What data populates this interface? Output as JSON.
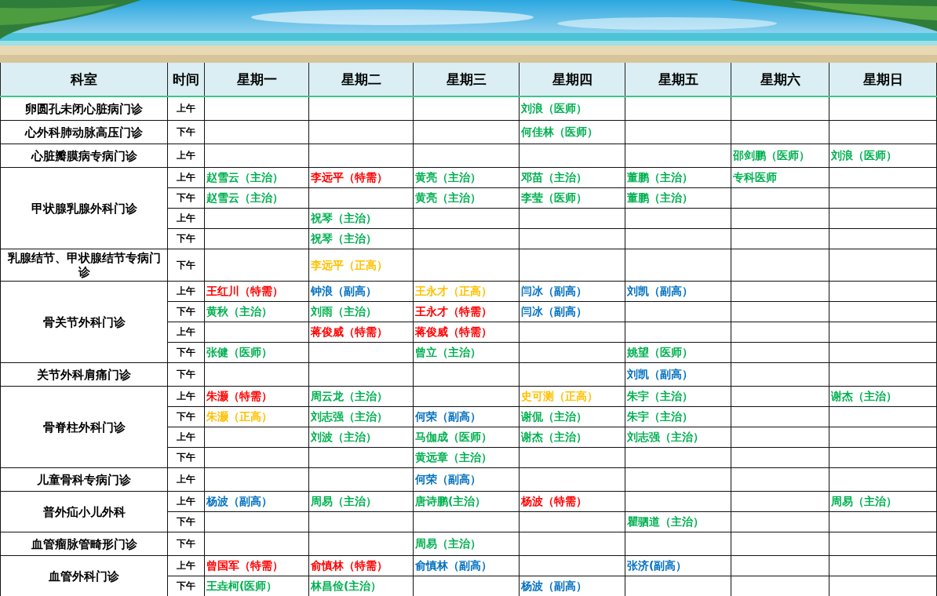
{
  "header": [
    "科室",
    "时间",
    "星期一",
    "星期二",
    "星期三",
    "星期四",
    "星期五",
    "星期六",
    "星期日"
  ],
  "departments": [
    {
      "name": "卵圆孔未闭心脏病门诊",
      "slots": [
        {
          "time": "上午",
          "cells": [
            null,
            null,
            null,
            {
              "text": "刘浪（医师）",
              "color": "#00b050"
            },
            null,
            null,
            null
          ]
        }
      ]
    },
    {
      "name": "心外科肺动脉高压门诊",
      "slots": [
        {
          "time": "下午",
          "cells": [
            null,
            null,
            null,
            {
              "text": "何佳林（医师）",
              "color": "#00b050"
            },
            null,
            null,
            null
          ]
        }
      ]
    },
    {
      "name": "心脏瓣膜病专病门诊",
      "slots": [
        {
          "time": "上午",
          "cells": [
            null,
            null,
            null,
            null,
            null,
            {
              "text": "邵剑鹏（医师）",
              "color": "#00b050"
            },
            {
              "text": "刘浪（医师）",
              "color": "#00b050"
            }
          ]
        }
      ]
    },
    {
      "name": "甲状腺乳腺外科门诊",
      "slots": [
        {
          "time": "上午",
          "cells": [
            {
              "text": "赵雪云（主治）",
              "color": "#00b050"
            },
            {
              "text": "李远平（特需）",
              "color": "#ff0000"
            },
            {
              "text": "黄亮（主治）",
              "color": "#00b050"
            },
            {
              "text": "邓苗（主治）",
              "color": "#00b050"
            },
            {
              "text": "董鹏（主治）",
              "color": "#00b050"
            },
            {
              "text": "专科医师",
              "color": "#00b050"
            },
            null
          ]
        },
        {
          "time": "下午",
          "cells": [
            {
              "text": "赵雪云（主治）",
              "color": "#00b050"
            },
            null,
            {
              "text": "黄亮（主治）",
              "color": "#00b050"
            },
            {
              "text": "李莹（医师）",
              "color": "#00b050"
            },
            {
              "text": "董鹏（主治）",
              "color": "#00b050"
            },
            null,
            null
          ]
        },
        {
          "time": "上午",
          "cells": [
            null,
            {
              "text": "祝琴（主治）",
              "color": "#00b050"
            },
            null,
            null,
            null,
            null,
            null
          ]
        },
        {
          "time": "下午",
          "cells": [
            null,
            {
              "text": "祝琴（主治）",
              "color": "#00b050"
            },
            null,
            null,
            null,
            null,
            null
          ]
        }
      ]
    },
    {
      "name": "乳腺结节、甲状腺结节专病门诊",
      "slots": [
        {
          "time": "下午",
          "cells": [
            null,
            {
              "text": "李远平（正高）",
              "color": "#ffc000"
            },
            null,
            null,
            null,
            null,
            null
          ]
        }
      ]
    },
    {
      "name": "骨关节外科门诊",
      "slots": [
        {
          "time": "上午",
          "cells": [
            {
              "text": "王红川（特需）",
              "color": "#ff0000"
            },
            {
              "text": "钟浪（副高）",
              "color": "#0070c0"
            },
            {
              "text": "王永才（正高）",
              "color": "#ffc000"
            },
            {
              "text": "闫冰（副高）",
              "color": "#0070c0"
            },
            {
              "text": "刘凯（副高）",
              "color": "#0070c0"
            },
            null,
            null
          ]
        },
        {
          "time": "下午",
          "cells": [
            {
              "text": "黄秋（主治）",
              "color": "#00b050"
            },
            {
              "text": "刘雨（主治）",
              "color": "#00b050"
            },
            {
              "text": "王永才（特需）",
              "color": "#ff0000"
            },
            {
              "text": "闫冰（副高）",
              "color": "#0070c0"
            },
            null,
            null,
            null
          ]
        },
        {
          "time": "上午",
          "cells": [
            null,
            {
              "text": "蒋俊威（特需）",
              "color": "#ff0000"
            },
            {
              "text": "蒋俊威（特需）",
              "color": "#ff0000"
            },
            null,
            null,
            null,
            null
          ]
        },
        {
          "time": "下午",
          "cells": [
            {
              "text": "张健（医师）",
              "color": "#00b050"
            },
            null,
            {
              "text": "曾立（主治）",
              "color": "#00b050"
            },
            null,
            {
              "text": "姚望（医师）",
              "color": "#00b050"
            },
            null,
            null
          ]
        }
      ]
    },
    {
      "name": "关节外科肩痛门诊",
      "slots": [
        {
          "time": "下午",
          "cells": [
            null,
            null,
            null,
            null,
            {
              "text": "刘凯（副高）",
              "color": "#0070c0"
            },
            null,
            null
          ]
        }
      ]
    },
    {
      "name": "骨脊柱外科门诊",
      "slots": [
        {
          "time": "上午",
          "cells": [
            {
              "text": "朱灏（特需）",
              "color": "#ff0000"
            },
            {
              "text": "周云龙（主治）",
              "color": "#00b050"
            },
            null,
            {
              "text": "史可测（正高）",
              "color": "#ffc000"
            },
            {
              "text": "朱宇（主治）",
              "color": "#00b050"
            },
            null,
            {
              "text": "谢杰（主治）",
              "color": "#00b050"
            }
          ]
        },
        {
          "time": "下午",
          "cells": [
            {
              "text": "朱灏（正高）",
              "color": "#ffc000"
            },
            {
              "text": "刘志强（主治）",
              "color": "#00b050"
            },
            {
              "text": "何荣（副高）",
              "color": "#0070c0"
            },
            {
              "text": "谢侃（主治）",
              "color": "#00b050"
            },
            {
              "text": "朱宇（主治）",
              "color": "#00b050"
            },
            null,
            null
          ]
        },
        {
          "time": "上午",
          "cells": [
            null,
            {
              "text": "刘波（主治）",
              "color": "#00b050"
            },
            {
              "text": "马伽成（医师）",
              "color": "#00b050"
            },
            {
              "text": "谢杰（主治）",
              "color": "#00b050"
            },
            {
              "text": "刘志强（主治）",
              "color": "#00b050"
            },
            null,
            null
          ]
        },
        {
          "time": "下午",
          "cells": [
            null,
            null,
            {
              "text": "黄远章（主治）",
              "color": "#00b050"
            },
            null,
            null,
            null,
            null
          ]
        }
      ]
    },
    {
      "name": "儿童骨科专病门诊",
      "slots": [
        {
          "time": "上午",
          "cells": [
            null,
            null,
            {
              "text": "何荣（副高）",
              "color": "#0070c0"
            },
            null,
            null,
            null,
            null
          ]
        }
      ]
    },
    {
      "name": "普外疝小儿外科",
      "slots": [
        {
          "time": "上午",
          "cells": [
            {
              "text": "杨波（副高）",
              "color": "#0070c0"
            },
            {
              "text": "周易（主治）",
              "color": "#00b050"
            },
            {
              "text": "唐诗鹏(主治）",
              "color": "#00b050"
            },
            {
              "text": "杨波（特需）",
              "color": "#ff0000"
            },
            null,
            null,
            {
              "text": "周易（主治）",
              "color": "#00b050"
            }
          ]
        },
        {
          "time": "下午",
          "cells": [
            null,
            null,
            null,
            null,
            {
              "text": "瞿驷道（主治）",
              "color": "#00b050"
            },
            null,
            null
          ]
        }
      ]
    },
    {
      "name": "血管瘤脉管畸形门诊",
      "slots": [
        {
          "time": "下午",
          "cells": [
            null,
            null,
            {
              "text": "周易（主治）",
              "color": "#00b050"
            },
            null,
            null,
            null,
            null
          ]
        }
      ]
    },
    {
      "name": "血管外科门诊",
      "slots": [
        {
          "time": "上午",
          "cells": [
            {
              "text": "曾国军（特需）",
              "color": "#ff0000"
            },
            {
              "text": "俞慎林（特需）",
              "color": "#ff0000"
            },
            {
              "text": "俞慎林（副高）",
              "color": "#0070c0"
            },
            null,
            {
              "text": "张济(副高）",
              "color": "#0070c0"
            },
            null,
            null
          ]
        },
        {
          "time": "下午",
          "cells": [
            {
              "text": "王垚柯(医师）",
              "color": "#00b050"
            },
            {
              "text": "林昌俭(主治）",
              "color": "#00b050"
            },
            null,
            {
              "text": "杨波（副高）",
              "color": "#0070c0"
            },
            null,
            null,
            null
          ]
        }
      ]
    }
  ]
}
